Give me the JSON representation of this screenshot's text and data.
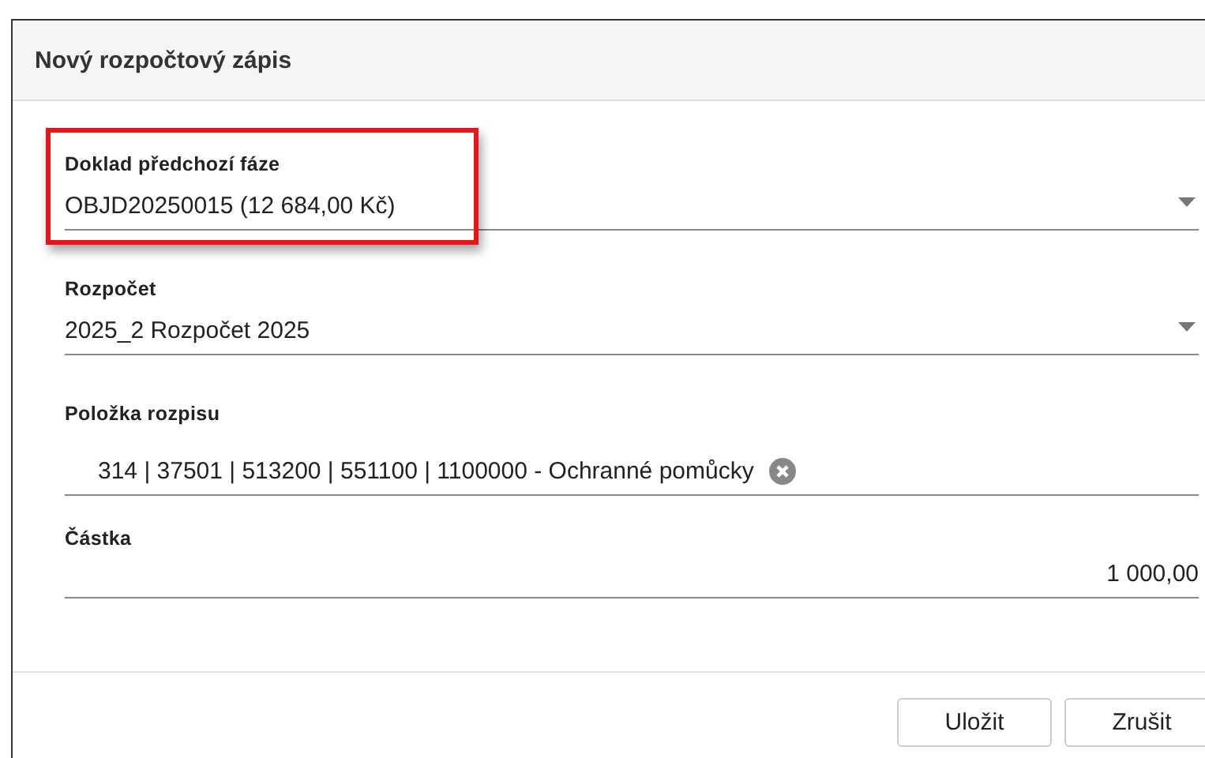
{
  "dialog": {
    "title": "Nový rozpočtový zápis"
  },
  "fields": [
    {
      "kind": "select",
      "label": "Doklad předchozí fáze",
      "value": "OBJD20250015 (12 684,00 Kč)",
      "highlighted": true
    },
    {
      "kind": "select",
      "label": "Rozpočet",
      "value": "2025_2 Rozpočet 2025",
      "highlighted": false
    },
    {
      "kind": "chip",
      "label": "Položka rozpisu",
      "value": "314 | 37501 | 513200 | 551100 | 1100000 - Ochranné pomůcky",
      "highlighted": false
    },
    {
      "kind": "number",
      "label": "Částka",
      "value": "1 000,00",
      "highlighted": false
    }
  ],
  "buttons": [
    "Uložit",
    "Zrušit"
  ]
}
